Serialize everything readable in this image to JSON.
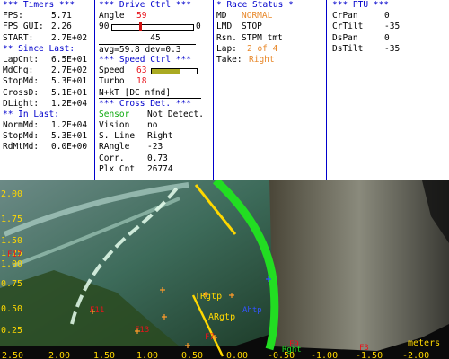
{
  "panel": {
    "timers": {
      "header": "*** Timers ***",
      "rows": [
        {
          "label": "FPS:",
          "value": "5.71"
        },
        {
          "label": "FPS_GUI:",
          "value": "2.26"
        },
        {
          "label": "START:",
          "value": "2.7E+02"
        }
      ],
      "since_last_header": "** Since Last:",
      "since_last": [
        {
          "label": "LapCnt:",
          "value": "6.5E+01"
        },
        {
          "label": "MdChg:",
          "value": "2.7E+02"
        },
        {
          "label": "StopMd:",
          "value": "5.3E+01"
        },
        {
          "label": "CrossD:",
          "value": "5.1E+01"
        },
        {
          "label": "DLight:",
          "value": "1.2E+04"
        }
      ],
      "in_last_header": "** In Last:",
      "in_last": [
        {
          "label": "NormMd:",
          "value": "1.2E+04"
        },
        {
          "label": "StopMd:",
          "value": "5.3E+01"
        },
        {
          "label": "RdMtMd:",
          "value": "0.0E+00"
        }
      ]
    },
    "drive": {
      "header": "*** Drive Ctrl  ***",
      "angle_label": "Angle",
      "angle_value": "59",
      "slider_min": "90",
      "slider_max": "0",
      "slider_level": 0.34,
      "slider_center": "45",
      "avg_text": "avg=59.8 dev=0.3",
      "speed_header": "*** Speed Ctrl  ***",
      "speed_label": "Speed",
      "speed_value": "63",
      "speed_level": 0.63,
      "turbo_label": "Turbo",
      "turbo_value": "18",
      "nkt_text": "N+kT [DC nfnd]",
      "cross_header": "*** Cross Det. ***",
      "cross_rows": [
        {
          "label": "Sensor",
          "value": "Not Detect."
        },
        {
          "label": "Vision",
          "value": "no"
        },
        {
          "label": "S. Line",
          "value": "Right"
        },
        {
          "label": "RAngle",
          "value": "-23"
        },
        {
          "label": "Corr.",
          "value": "0.73"
        },
        {
          "label": "Plx Cnt",
          "value": "26774"
        }
      ]
    },
    "race": {
      "header": "* Race Status *",
      "rows": [
        {
          "label": "MD",
          "value": "NORMAL"
        },
        {
          "label": "LMD",
          "value": "STOP"
        },
        {
          "label": "Rsn.",
          "value": "STPM tmt"
        },
        {
          "label": "Lap:",
          "value": "2 of 4"
        },
        {
          "label": "Take:",
          "value": "Right"
        }
      ]
    },
    "ptu": {
      "header": "*** PTU ***",
      "rows": [
        {
          "label": "CrPan",
          "value": "0"
        },
        {
          "label": "CrTilt",
          "value": "-35"
        },
        {
          "label": "DsPan",
          "value": "0"
        },
        {
          "label": "DsTilt",
          "value": "-35"
        }
      ]
    }
  },
  "camera": {
    "y_ticks": [
      "2.00",
      "1.75",
      "1.50",
      "1.25",
      "1.00",
      "0.75",
      "0.50",
      "0.25"
    ],
    "x_ticks": [
      "2.50",
      "2.00",
      "1.50",
      "1.00",
      "0.50",
      "0.00",
      "-0.50",
      "-1.00",
      "-1.50",
      "-2.00"
    ],
    "units": "meters",
    "markers": [
      {
        "label": "TRgtp"
      },
      {
        "label": "ARgtp"
      },
      {
        "label": "Ahtp"
      },
      {
        "label": "F11"
      },
      {
        "label": "F13"
      },
      {
        "label": "F7"
      },
      {
        "label": "F17"
      },
      {
        "label": "F3"
      },
      {
        "label": "F9"
      },
      {
        "label": "Rght"
      }
    ]
  },
  "colors": {
    "header": "#0000cc",
    "value_red": "#e8141c",
    "value_orange": "#e8882a",
    "sensor_green": "#11aa11",
    "ruler_yellow": "#ffd800",
    "track_green": "#22dd22"
  }
}
